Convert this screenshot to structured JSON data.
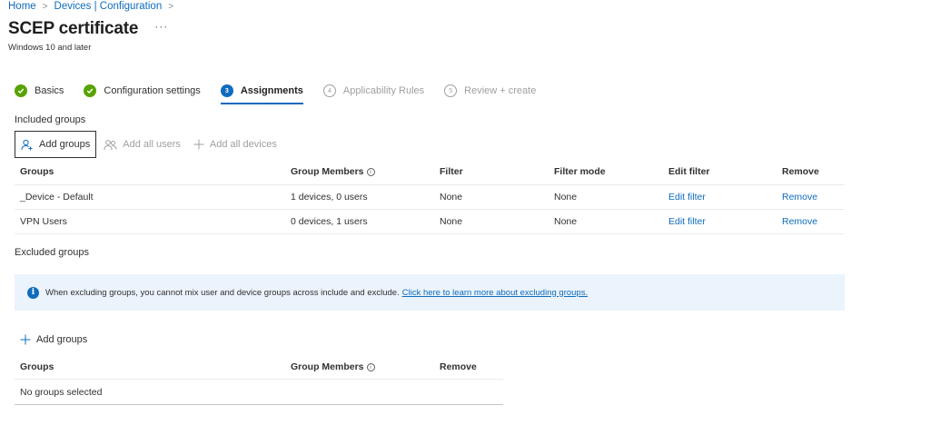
{
  "breadcrumb": {
    "items": [
      "Home",
      "Devices | Configuration"
    ]
  },
  "header": {
    "title": "SCEP certificate",
    "more": "···",
    "subtitle": "Windows 10 and later"
  },
  "wizard": {
    "steps": [
      {
        "label": "Basics",
        "status": "done"
      },
      {
        "label": "Configuration settings",
        "status": "done"
      },
      {
        "label": "Assignments",
        "status": "current",
        "number": "3"
      },
      {
        "label": "Applicability Rules",
        "status": "pending",
        "number": "4"
      },
      {
        "label": "Review + create",
        "status": "pending",
        "number": "5"
      }
    ]
  },
  "included": {
    "label": "Included groups",
    "commands": {
      "add_groups": "Add groups",
      "add_all_users": "Add all users",
      "add_all_devices": "Add all devices"
    },
    "columns": [
      "Groups",
      "Group Members",
      "Filter",
      "Filter mode",
      "Edit filter",
      "Remove"
    ],
    "rows": [
      {
        "group": "_Device - Default",
        "members": "1 devices, 0 users",
        "filter": "None",
        "filter_mode": "None",
        "edit_filter": "Edit filter",
        "remove": "Remove"
      },
      {
        "group": "VPN Users",
        "members": "0 devices, 1 users",
        "filter": "None",
        "filter_mode": "None",
        "edit_filter": "Edit filter",
        "remove": "Remove"
      }
    ]
  },
  "excluded": {
    "label": "Excluded groups",
    "banner": {
      "text": "When excluding groups, you cannot mix user and device groups across include and exclude.",
      "link": "Click here to learn more about excluding groups."
    },
    "add_groups": "Add groups",
    "columns": [
      "Groups",
      "Group Members",
      "Remove"
    ],
    "empty_text": "No groups selected"
  },
  "colors": {
    "accent": "#0f6cbd",
    "success": "#57a300",
    "banner_bg": "#ebf3fc"
  },
  "icons": {
    "check": "checkmark-circle-icon",
    "info": "info-icon",
    "add_person": "person-add-icon",
    "people": "people-icon",
    "plus": "plus-icon"
  }
}
